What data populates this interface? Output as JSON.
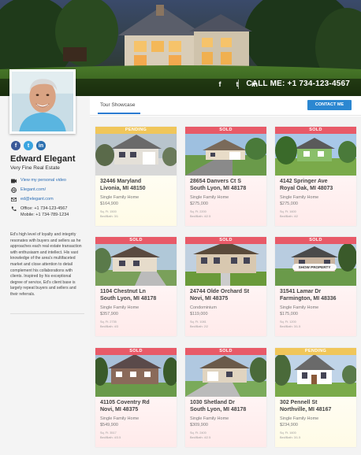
{
  "header": {
    "social": [
      "f",
      "t",
      "in"
    ],
    "call_label": "CALL ME: +1 734-123-4567"
  },
  "agent": {
    "name": "Edward Elegant",
    "company": "Very Fine Real Estate",
    "social": [
      "f",
      "t",
      "in"
    ],
    "video_link": "View my personal video",
    "website": "Elegant.com/",
    "email": "ed@elegant.com",
    "office": "Office: +1 734-123-4567",
    "mobile": "Mobile: +1 734-789-1234",
    "bio": "Ed's high level of loyalty and integrity resonates with buyers and sellers as he approaches each real estate transaction with enthusiasm and intellect. His vast knowledge of the area's multifaceted market and close attention to detail complement his collaborations with clients. Inspired by his exceptional degree of service, Ed's client base is largely repeat buyers and sellers and their referrals."
  },
  "main": {
    "tab": "Tour Showcase",
    "contact_button": "CONTACT ME",
    "show_property": "SHOW PROPERTY"
  },
  "listings": [
    {
      "status": "PENDING",
      "addr1": "32446 Maryland",
      "addr2": "Livonia, MI 48150",
      "type": "Single Family Home",
      "price": "$164,900",
      "sqft": "Sq. Ft. 1500",
      "beds": "Bed/Bath: 3/1"
    },
    {
      "status": "SOLD",
      "addr1": "28654 Danvers Ct S",
      "addr2": "South Lyon, MI 48178",
      "type": "Single Family Home",
      "price": "$275,000",
      "sqft": "Sq. Ft. 2200",
      "beds": "Bed/Bath: 4/2.5"
    },
    {
      "status": "SOLD",
      "addr1": "4142 Springer Ave",
      "addr2": "Royal Oak, MI 48073",
      "type": "Single Family Home",
      "price": "$275,000",
      "sqft": "Sq. Ft. 1600",
      "beds": "Bed/Bath: 4/2"
    },
    {
      "status": "SOLD",
      "addr1": "1104 Chestnut Ln",
      "addr2": "South Lyon, MI 48178",
      "type": "Single Family Home",
      "price": "$357,900",
      "sqft": "Sq. Ft. 2735",
      "beds": "Bed/Bath: 4/3"
    },
    {
      "status": "SOLD",
      "addr1": "24744 Olde Orchard St",
      "addr2": "Novi, MI 48375",
      "type": "Condominium",
      "price": "$119,000",
      "sqft": "Sq. Ft. 1081",
      "beds": "Bed/Bath: 2/2"
    },
    {
      "status": "SOLD",
      "addr1": "31541 Lamar Dr",
      "addr2": "Farmington, MI 48336",
      "type": "Single Family Home",
      "price": "$175,000",
      "sqft": "Sq. Ft. 1200",
      "beds": "Bed/Bath: 3/1.5"
    },
    {
      "status": "SOLD",
      "addr1": "41105 Coventry Rd",
      "addr2": "Novi, MI 48375",
      "type": "Single Family Home",
      "price": "$549,900",
      "sqft": "Sq. Ft. 3517",
      "beds": "Bed/Bath: 4/3.5"
    },
    {
      "status": "SOLD",
      "addr1": "1030 Shetland Dr",
      "addr2": "South Lyon, MI 48178",
      "type": "Single Family Home",
      "price": "$309,900",
      "sqft": "Sq. Ft. 2400",
      "beds": "Bed/Bath: 4/2.5"
    },
    {
      "status": "PENDING",
      "addr1": "302 Pennell St",
      "addr2": "Northville, MI 48167",
      "type": "Single Family Home",
      "price": "$234,900",
      "sqft": "Sq. Ft. 1600",
      "beds": "Bed/Bath: 3/1.5"
    }
  ],
  "colors": {
    "accent": "#2b87d1",
    "sold": "#e85a68",
    "pending": "#f0c65a"
  }
}
